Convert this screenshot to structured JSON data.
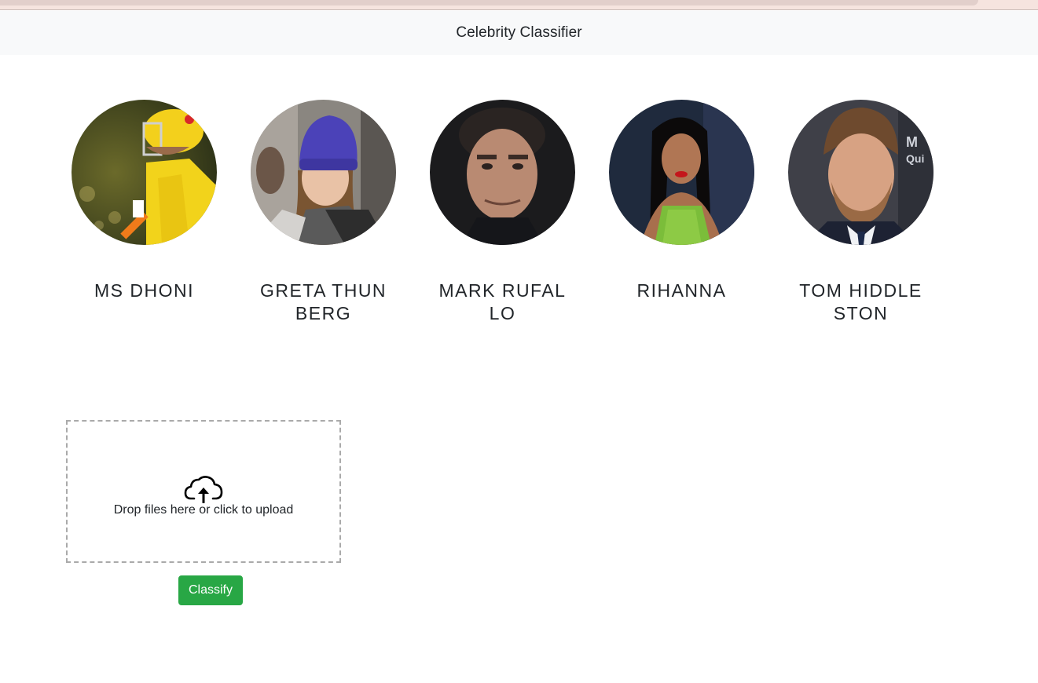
{
  "navbar": {
    "title": "Celebrity Classifier"
  },
  "celebrities": [
    {
      "name": "MS DHONI",
      "image": "ms-dhoni-photo"
    },
    {
      "name": "GRETA THUNBERG",
      "image": "greta-thunberg-photo"
    },
    {
      "name": "MARK RUFALLO",
      "image": "mark-rufallo-photo"
    },
    {
      "name": "RIHANNA",
      "image": "rihanna-photo"
    },
    {
      "name": "TOM HIDDLESTON",
      "image": "tom-hiddleston-photo"
    }
  ],
  "upload": {
    "icon": "cloud-upload-icon",
    "text": "Drop files here or click to upload"
  },
  "classify_button": {
    "label": "Classify"
  },
  "colors": {
    "navbar_bg": "#f8f9fa",
    "button_bg": "#28a745",
    "dropzone_border": "#aaaaaa"
  }
}
